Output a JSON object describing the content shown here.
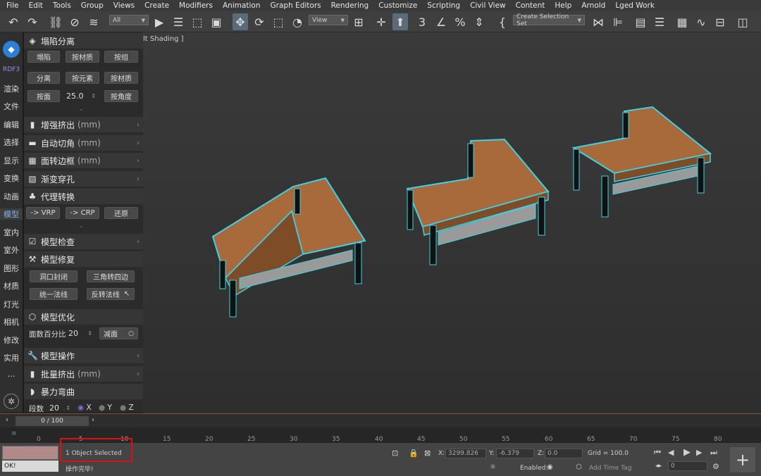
{
  "menubar": {
    "items": [
      "File",
      "Edit",
      "Tools",
      "Group",
      "Views",
      "Create",
      "Modifiers",
      "Animation",
      "Graph Editors",
      "Rendering",
      "Customize",
      "Scripting",
      "Civil View",
      "Content",
      "Help",
      "Arnold",
      "Lged Work"
    ]
  },
  "toolbar": {
    "filter_select": "All",
    "view_select": "View",
    "selection_set": "Create Selection Set",
    "snap_value": "3"
  },
  "left_strip": {
    "logo_text": "RDF3",
    "items": [
      "渲染",
      "文件",
      "编辑",
      "选择",
      "显示",
      "变换",
      "动画",
      "模型",
      "室内",
      "室外",
      "图形",
      "材质",
      "灯光",
      "相机",
      "修改",
      "实用"
    ],
    "more": "···",
    "active": "模型"
  },
  "panel": {
    "collapse": {
      "title": "塌陷分离",
      "btns_row1": [
        "塌陷",
        "按材质",
        "按组"
      ],
      "btns_row2": [
        "分离",
        "按元素",
        "按材质"
      ],
      "btn_face": "按面",
      "angle_value": "25.0",
      "btn_angle": "按角度"
    },
    "sections": [
      {
        "title": "增强挤出",
        "unit": "(mm)"
      },
      {
        "title": "自动切角",
        "unit": "(mm)"
      },
      {
        "title": "面转边框",
        "unit": "(mm)"
      },
      {
        "title": "渐变穿孔",
        "unit": ""
      }
    ],
    "proxy": {
      "title": "代理转换",
      "btns": [
        "-> VRP",
        "-> CRP",
        "还原"
      ]
    },
    "check": {
      "title": "模型检查"
    },
    "repair": {
      "title": "模型修复",
      "btns": [
        "洞口封闭",
        "三角转四边",
        "统一法线",
        "反转法线"
      ]
    },
    "optimize": {
      "title": "模型优化",
      "label": "面数百分比",
      "value": "20",
      "btn": "减面"
    },
    "ops": {
      "title": "模型操作"
    },
    "batch": {
      "title": "批量挤出",
      "unit": "(mm)"
    },
    "bend": {
      "title": "暴力弯曲",
      "label": "段数",
      "value": "20",
      "axes": [
        "X",
        "Y",
        "Z"
      ]
    }
  },
  "viewport": {
    "label": "lt Shading ]"
  },
  "timeline": {
    "frame": "0 / 100",
    "ticks": [
      "0",
      "5",
      "10",
      "15",
      "20",
      "25",
      "30",
      "35",
      "40",
      "45",
      "50",
      "55",
      "60",
      "65",
      "70",
      "75",
      "80"
    ]
  },
  "status": {
    "selected": "1 Object Selected",
    "ok": "OK!",
    "done": "操作完毕!",
    "x_label": "X:",
    "x_value": "3299.826",
    "y_label": "Y:",
    "y_value": "-6.379",
    "z_label": "Z:",
    "z_value": "0.0",
    "grid": "Grid = 100.0",
    "enabled": "Enabled:",
    "add_time_tag": "Add Time Tag",
    "frame_field": "0"
  },
  "colors": {
    "accent": "#2d7fd3",
    "selection": "#3fd2e6",
    "desk_top": "#a86a3a",
    "legs": "#111111",
    "status_highlight": "#e01010"
  }
}
